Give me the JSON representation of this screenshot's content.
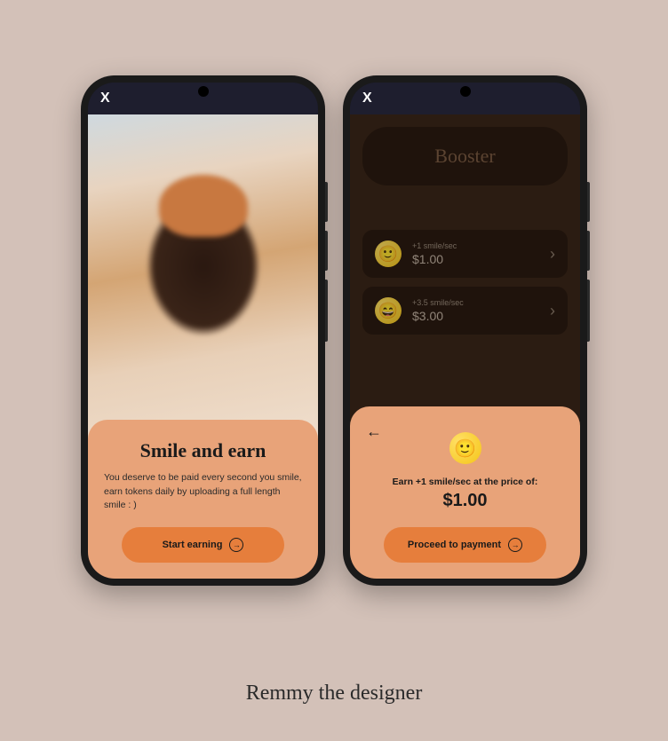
{
  "signature": "Remmy the designer",
  "close_label": "X",
  "phone1": {
    "card": {
      "title": "Smile and earn",
      "body": "You deserve to be paid every second you smile, earn tokens daily by uploading a full length smile : )",
      "cta": "Start earning"
    }
  },
  "phone2": {
    "booster_title": "Booster",
    "items": [
      {
        "rate": "+1 smile/sec",
        "price": "$1.00"
      },
      {
        "rate": "+3.5 smile/sec",
        "price": "$3.00"
      }
    ],
    "checkout": {
      "desc": "Earn +1 smile/sec at the price of:",
      "price": "$1.00",
      "cta": "Proceed to payment"
    }
  }
}
